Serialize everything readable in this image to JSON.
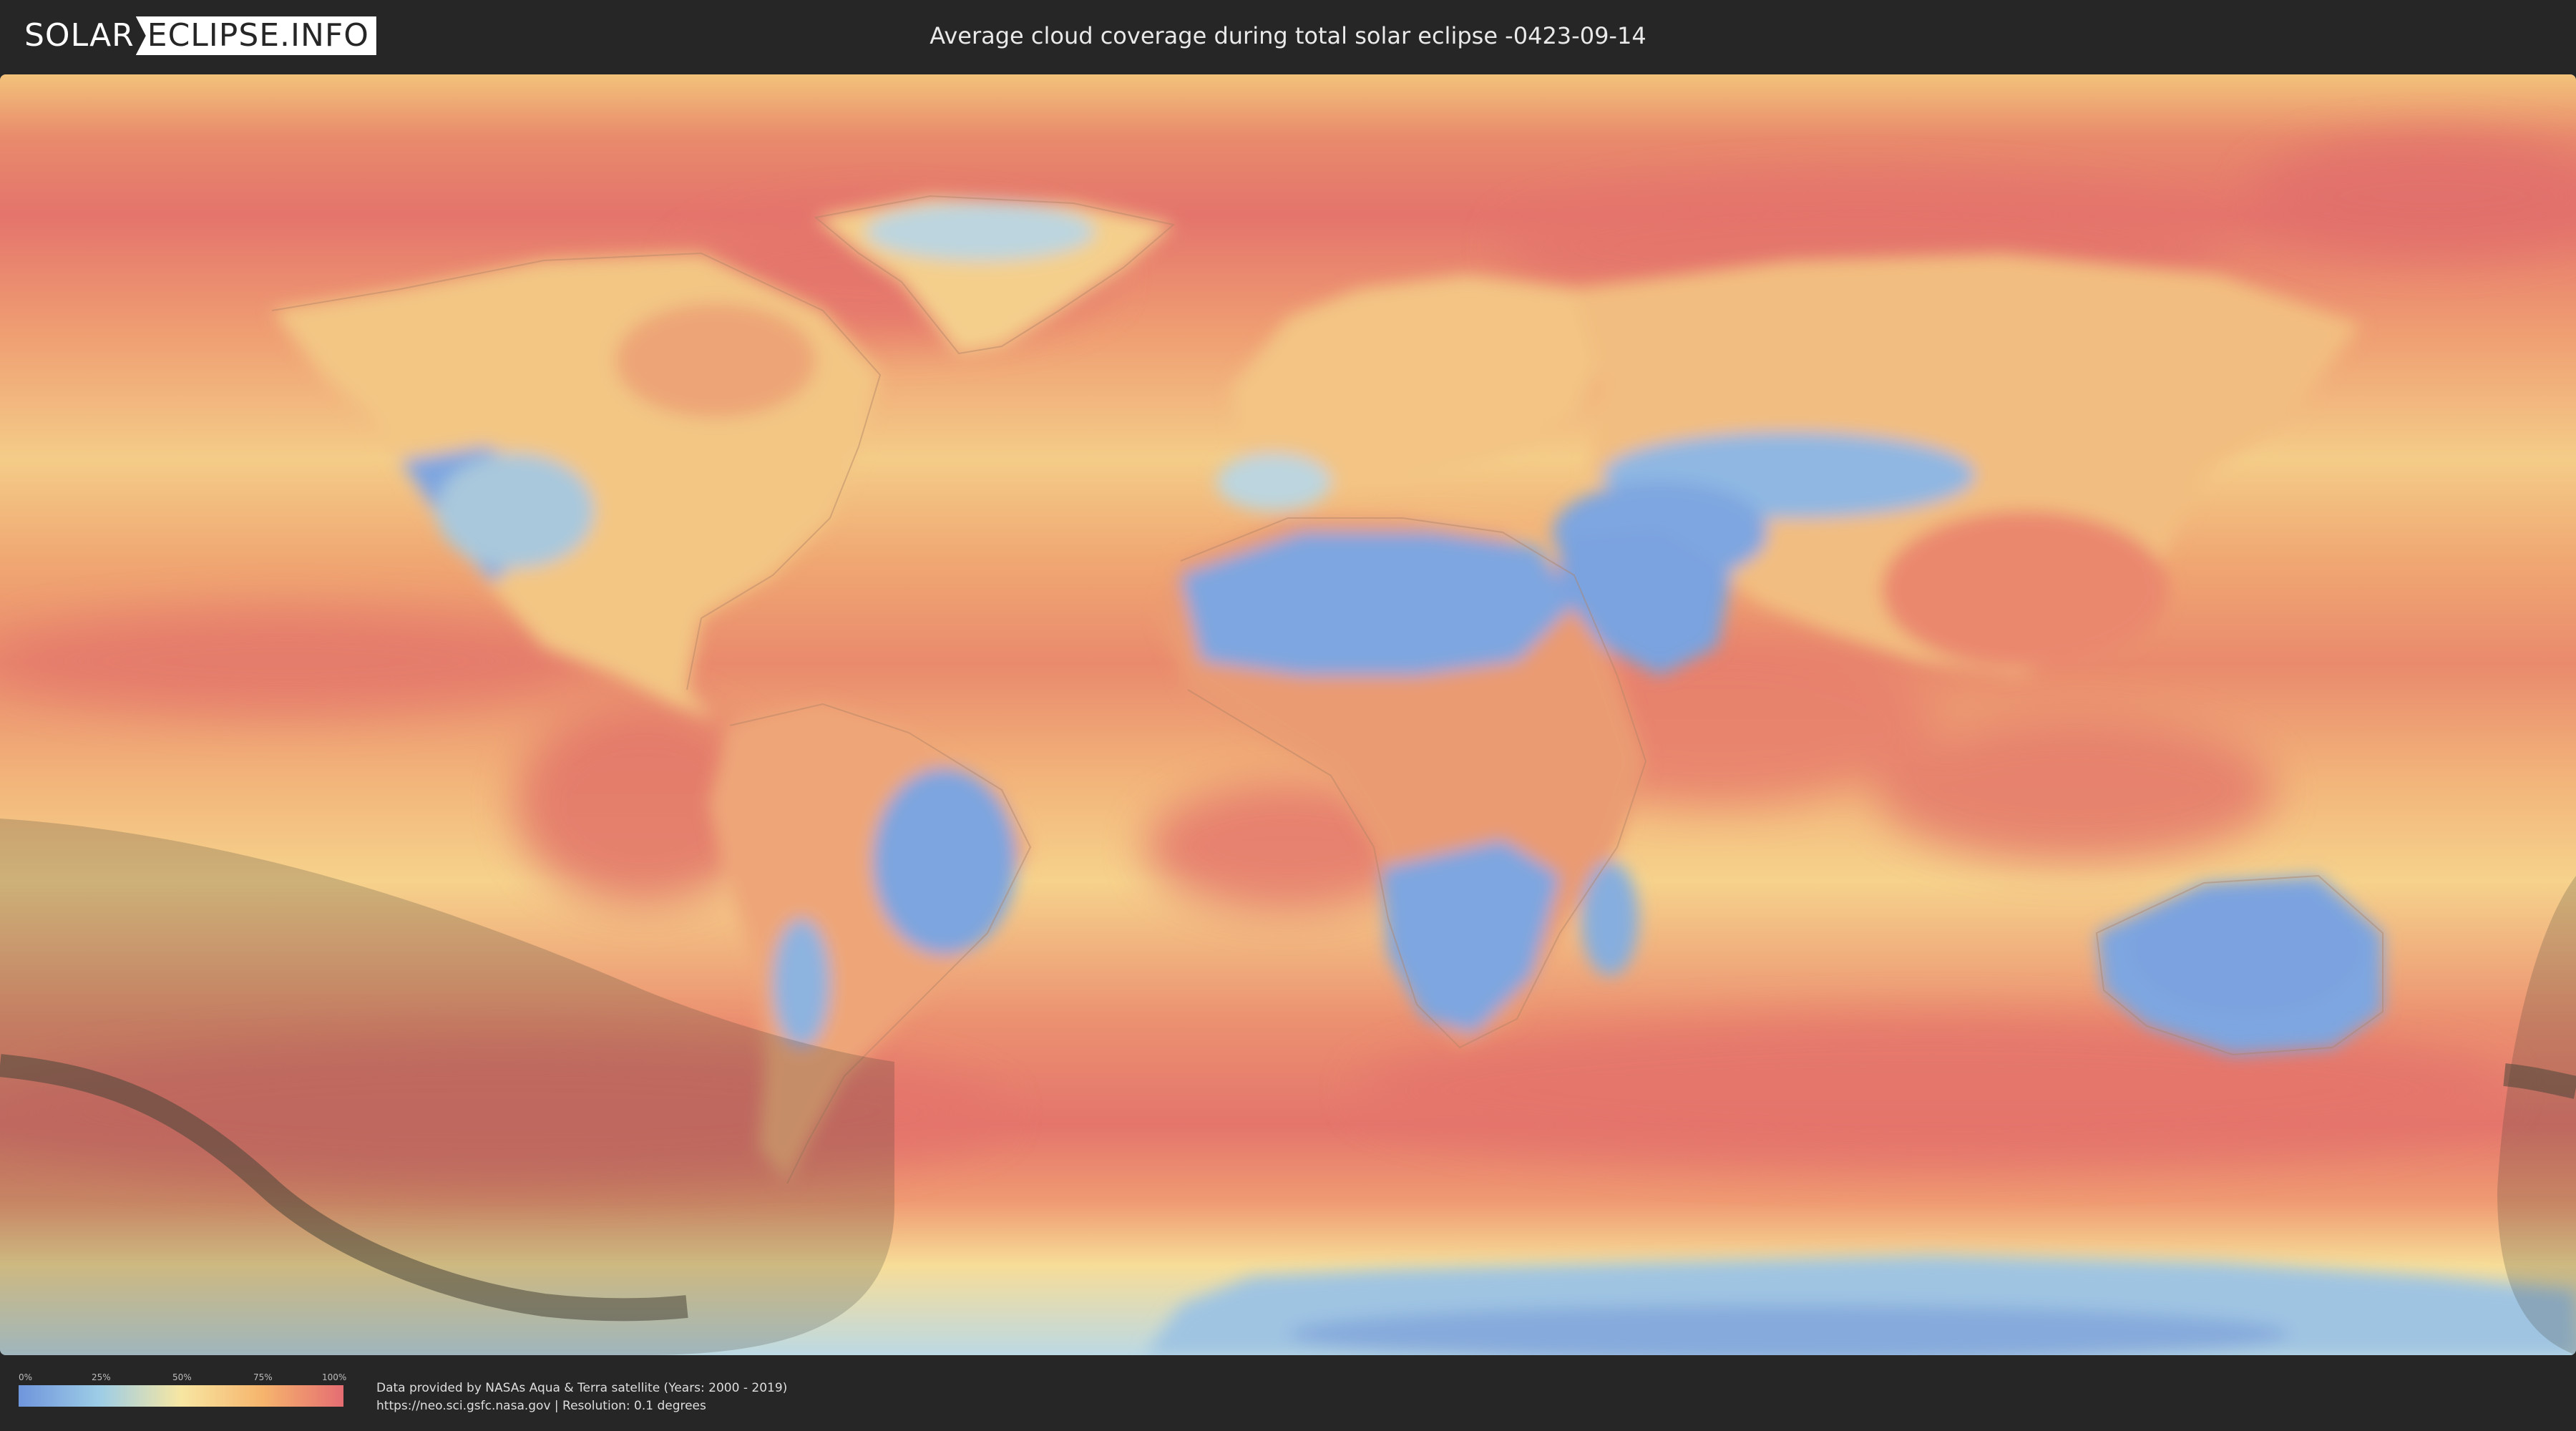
{
  "header": {
    "logo": {
      "solar": "SOLAR",
      "eclipse": "ECLIPSE.INFO"
    },
    "title": "Average cloud coverage during total solar eclipse -0423-09-14"
  },
  "map": {
    "projection": "equirectangular",
    "layer": "average cloud coverage",
    "eclipse_overlays": [
      "penumbra-shadow",
      "totality-path"
    ]
  },
  "legend": {
    "ticks": [
      "0%",
      "25%",
      "50%",
      "75%",
      "100%"
    ],
    "colors": [
      "#6f95dc",
      "#9dcde6",
      "#f7e6a2",
      "#f6b56d",
      "#e56d72"
    ]
  },
  "footer": {
    "credit_line1": "Data provided by NASAs Aqua & Terra satellite (Years: 2000 - 2019)",
    "credit_line2": "https://neo.sci.gsfc.nasa.gov | Resolution: 0.1 degrees"
  }
}
